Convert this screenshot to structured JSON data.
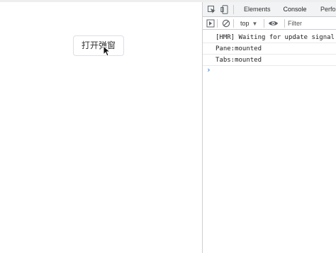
{
  "page": {
    "button_label": "打开弹窗"
  },
  "devtools": {
    "tabs": [
      {
        "label": "Elements",
        "active": false
      },
      {
        "label": "Console",
        "active": true
      },
      {
        "label": "Perfo",
        "active": false
      }
    ],
    "icons": {
      "inspect": "inspect-element-icon",
      "device_toolbar": "device-toolbar-icon",
      "sidebar": "console-sidebar-icon",
      "clear": "clear-console-icon",
      "live_expression": "eye-icon",
      "context_dropdown": "chevron-down-icon",
      "prompt": "console-prompt-icon"
    },
    "toolbar": {
      "context": "top",
      "filter_placeholder": "Filter"
    },
    "console": {
      "messages": [
        "[HMR] Waiting for update signal",
        "Pane:mounted",
        "Tabs:mounted"
      ],
      "prompt": "›"
    }
  },
  "colors": {
    "accent": "#1a73e8",
    "devtools_bar": "#f1f3f4",
    "border": "#dcdfe6"
  }
}
